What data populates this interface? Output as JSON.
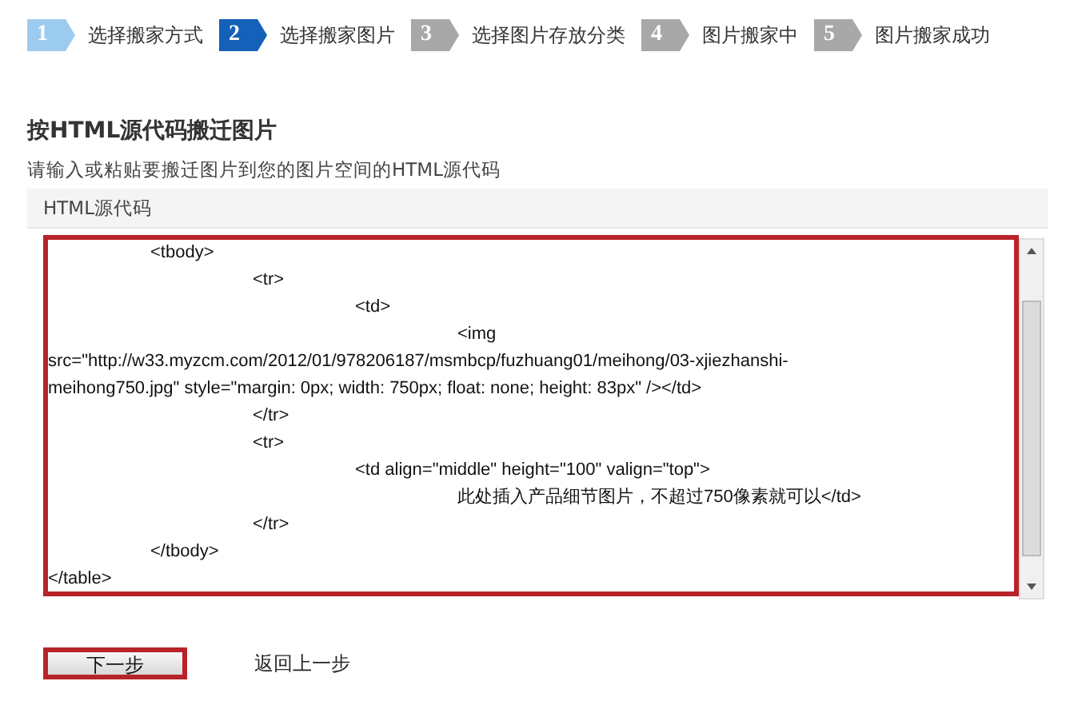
{
  "steps": [
    {
      "number": "1",
      "label": "选择搬家方式",
      "completed": true,
      "selected": false
    },
    {
      "number": "2",
      "label": "选择搬家图片",
      "completed": false,
      "selected": true
    },
    {
      "number": "3",
      "label": "选择图片存放分类",
      "completed": false,
      "selected": false
    },
    {
      "number": "4",
      "label": "图片搬家中",
      "completed": false,
      "selected": false
    },
    {
      "number": "5",
      "label": "图片搬家成功",
      "completed": false,
      "selected": false
    }
  ],
  "heading": "按HTML源代码搬迁图片",
  "instruction": "请输入或粘贴要搬迁图片到您的图片空间的HTML源代码",
  "panel": {
    "title": "HTML源代码",
    "highlighted": true,
    "code_lines": [
      "\t<tbody>",
      "\t\t<tr>",
      "\t\t\t<td>",
      "\t\t\t\t<img",
      "src=\"http://w33.myzcm.com/2012/01/978206187/msmbcp/fuzhuang01/meihong/03-xjiezhanshi-",
      "meihong750.jpg\" style=\"margin: 0px; width: 750px; float: none; height: 83px\" /></td>",
      "\t\t</tr>",
      "\t\t<tr>",
      "\t\t\t<td align=\"middle\" height=\"100\" valign=\"top\">",
      "\t\t\t\t此处插入产品细节图片，不超过750像素就可以</td>",
      "\t\t</tr>",
      "\t</tbody>",
      "</table>"
    ]
  },
  "next_button": {
    "label": "下一步",
    "highlighted": true
  },
  "back_link": "返回上一步"
}
